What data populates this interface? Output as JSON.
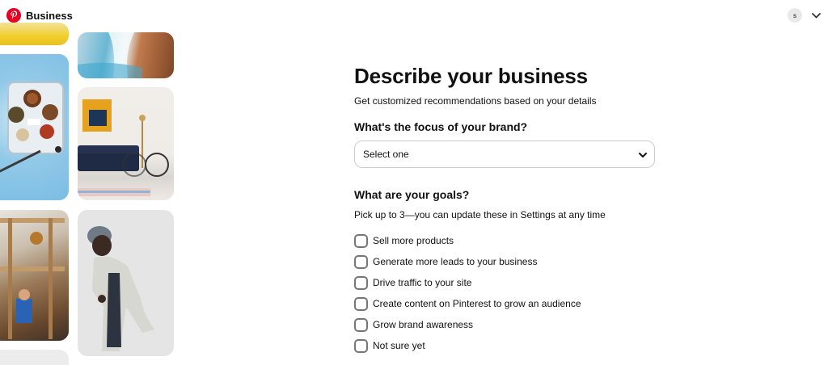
{
  "header": {
    "brand_name": "Business",
    "avatar_initial": "s",
    "pinterest_red": "#e60023"
  },
  "form": {
    "title": "Describe your business",
    "subtitle": "Get customized recommendations based on your details",
    "focus_question": "What's the focus of your brand?",
    "focus_select": {
      "value": "Select one",
      "icon": "chevron-down-icon"
    },
    "goals_question": "What are your goals?",
    "goals_hint": "Pick up to 3—you can update these in Settings at any time",
    "goals": [
      {
        "label": "Sell more products",
        "checked": false
      },
      {
        "label": "Generate more leads to your business",
        "checked": false
      },
      {
        "label": "Drive traffic to your site",
        "checked": false
      },
      {
        "label": "Create content on Pinterest to grow an audience",
        "checked": false
      },
      {
        "label": "Grow brand awareness",
        "checked": false
      },
      {
        "label": "Not sure yet",
        "checked": false
      }
    ]
  }
}
